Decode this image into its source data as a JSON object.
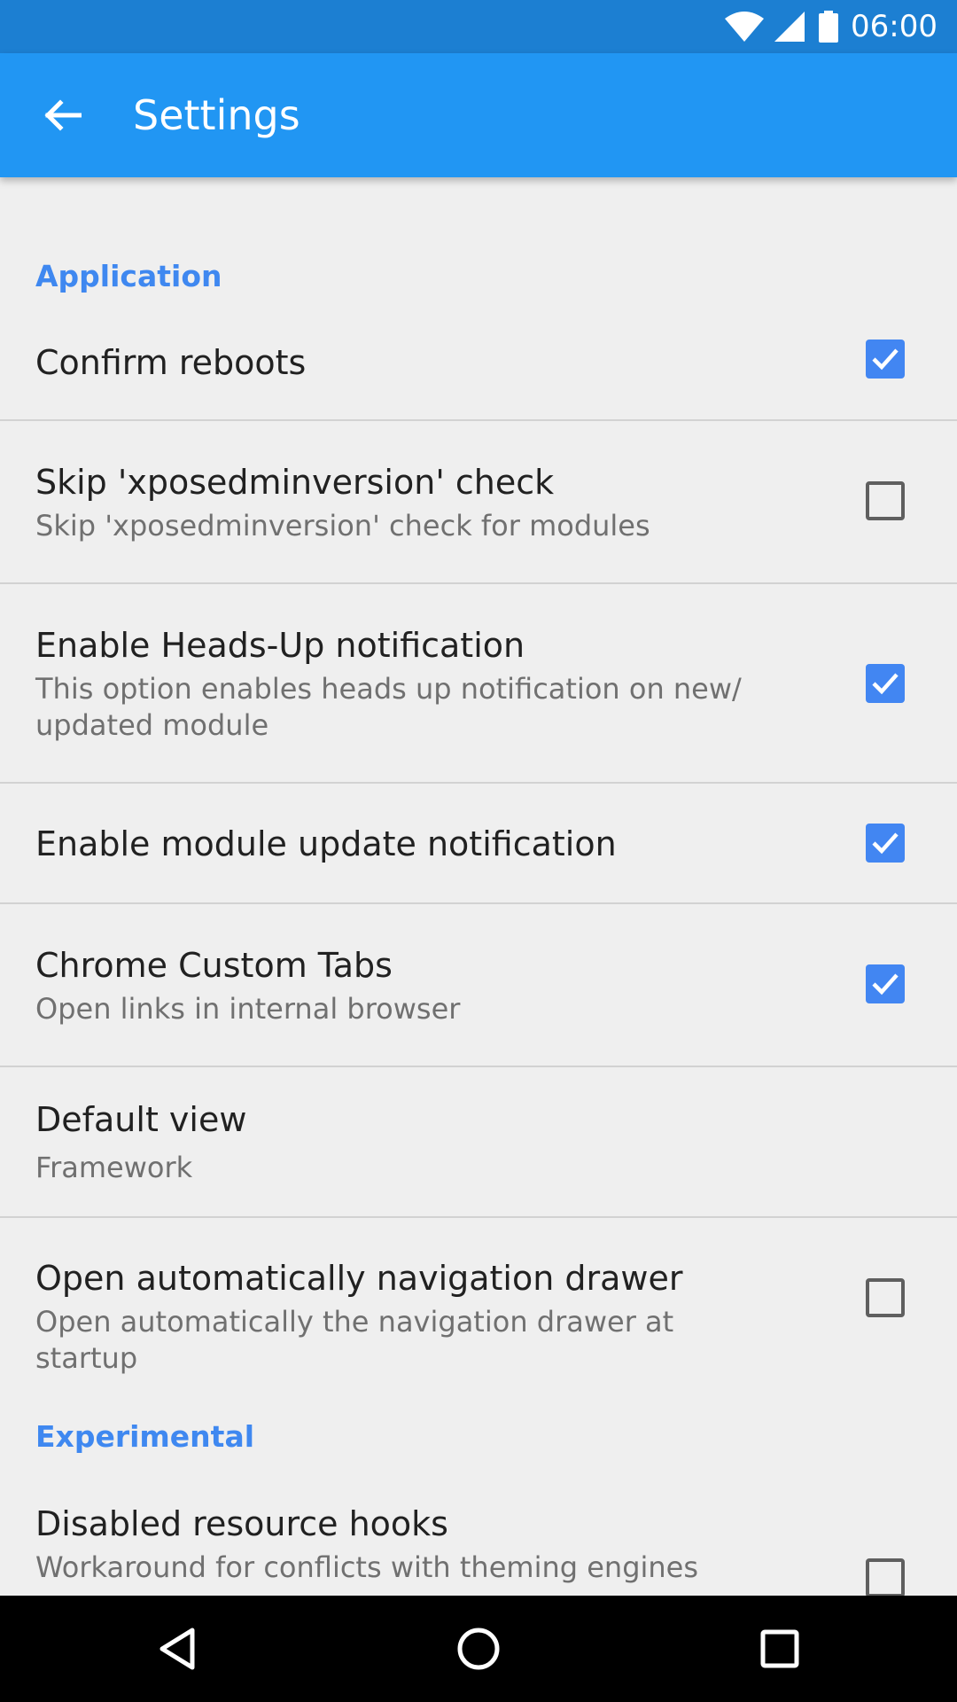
{
  "status_bar": {
    "time": "06:00",
    "icons": [
      "wifi-icon",
      "cell-signal-icon",
      "battery-icon"
    ]
  },
  "app_bar": {
    "back_icon": "arrow-back-icon",
    "title": "Settings",
    "color": "#2196f3"
  },
  "sections": {
    "application": "Application",
    "experimental": "Experimental"
  },
  "prefs": {
    "confirm_reboots": {
      "title": "Confirm reboots",
      "checked": true
    },
    "skip_check": {
      "title": "Skip 'xposedminversion' check",
      "summary": "Skip 'xposedminversion' check for modules",
      "checked": false
    },
    "heads_up": {
      "title": "Enable Heads-Up notification",
      "summary_line1": "This option enables heads up notification on new/",
      "summary_line2": "updated module",
      "checked": true
    },
    "module_update": {
      "title": "Enable module update notification",
      "checked": true
    },
    "custom_tabs": {
      "title": "Chrome Custom Tabs",
      "summary": "Open links in internal browser",
      "checked": true
    },
    "default_view": {
      "title": "Default view",
      "value": "Framework"
    },
    "open_drawer": {
      "title": "Open automatically navigation drawer",
      "summary": "Open automatically the navigation drawer at startup",
      "checked": false
    },
    "disabled_hooks": {
      "title": "Disabled resource hooks",
      "summary": "Workaround for conflicts with theming engines",
      "checked": false
    }
  },
  "nav_bar": {
    "back": "nav-back-icon",
    "home": "nav-home-icon",
    "recents": "nav-recents-icon"
  },
  "colors": {
    "accent": "#4286f2",
    "status_bar": "#1c7fd2",
    "section_header": "#3f88f0"
  }
}
